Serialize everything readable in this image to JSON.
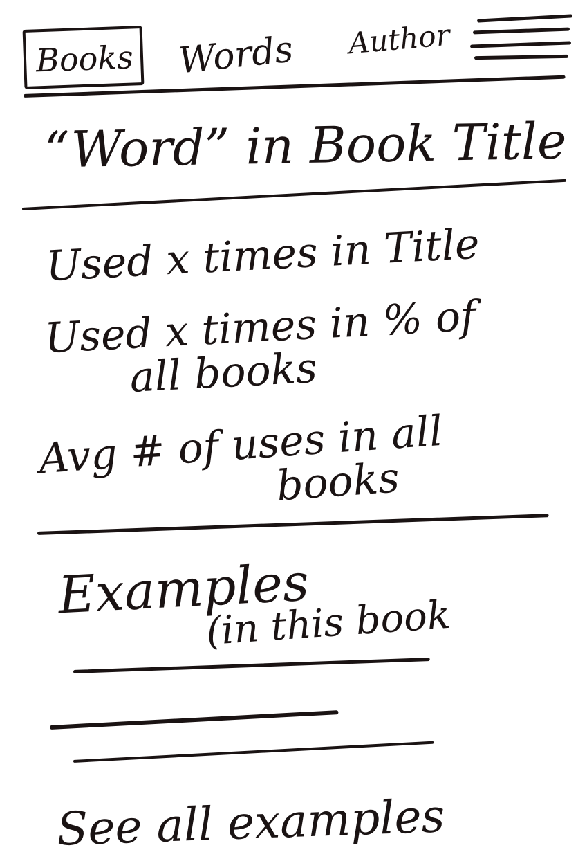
{
  "nav": {
    "tabs": [
      {
        "label": "Books",
        "active": true
      },
      {
        "label": "Words",
        "active": false
      },
      {
        "label": "Author",
        "active": false
      }
    ],
    "menu_icon": "hamburger-icon"
  },
  "heading": "“Word” in Book Title",
  "stats": [
    {
      "line1": "Used x times in Title",
      "line2": ""
    },
    {
      "line1": "Used x times in % of",
      "line2": "all books"
    },
    {
      "line1": "Avg # of uses in all",
      "line2": "books"
    }
  ],
  "examples": {
    "title": "Examples",
    "subtitle": "(in this book"
  },
  "see_all_label": "See all examples",
  "colors": {
    "ink": "#1a1313",
    "paper": "#ffffff"
  }
}
